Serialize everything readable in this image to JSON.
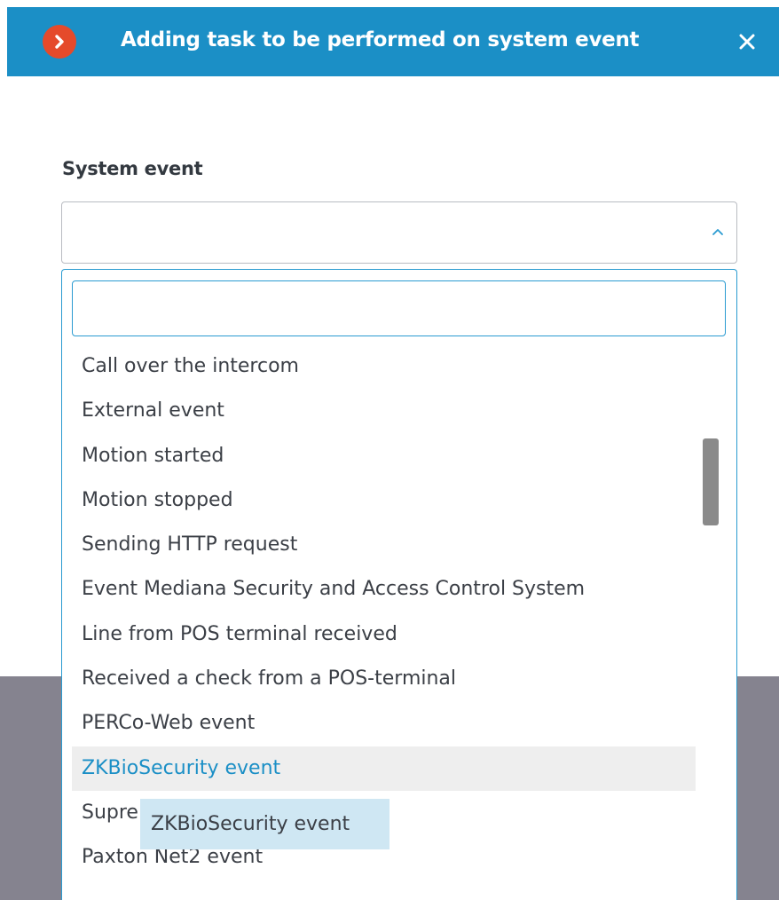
{
  "dialog": {
    "title": "Adding task to be performed on system event",
    "logo_icon": "chevron-right-circle-icon",
    "close_icon": "close-icon",
    "colors": {
      "titlebar": "#1b8fc6",
      "logo": "#e54a2b",
      "accent": "#2a9bd1"
    }
  },
  "form": {
    "system_event_label": "System event",
    "system_event_value": "",
    "search_value": ""
  },
  "dropdown": {
    "items": [
      "Call over the intercom",
      "External event",
      "Motion started",
      "Motion stopped",
      "Sending HTTP request",
      "Event Mediana Security and Access Control System",
      "Line from POS terminal received",
      "Received a check from a POS-terminal",
      "PERCo-Web event",
      "ZKBioSecurity event",
      "Suprema event",
      "Paxton Net2 event"
    ],
    "highlighted_index": 9
  },
  "tooltip": {
    "text": "ZKBioSecurity event"
  }
}
